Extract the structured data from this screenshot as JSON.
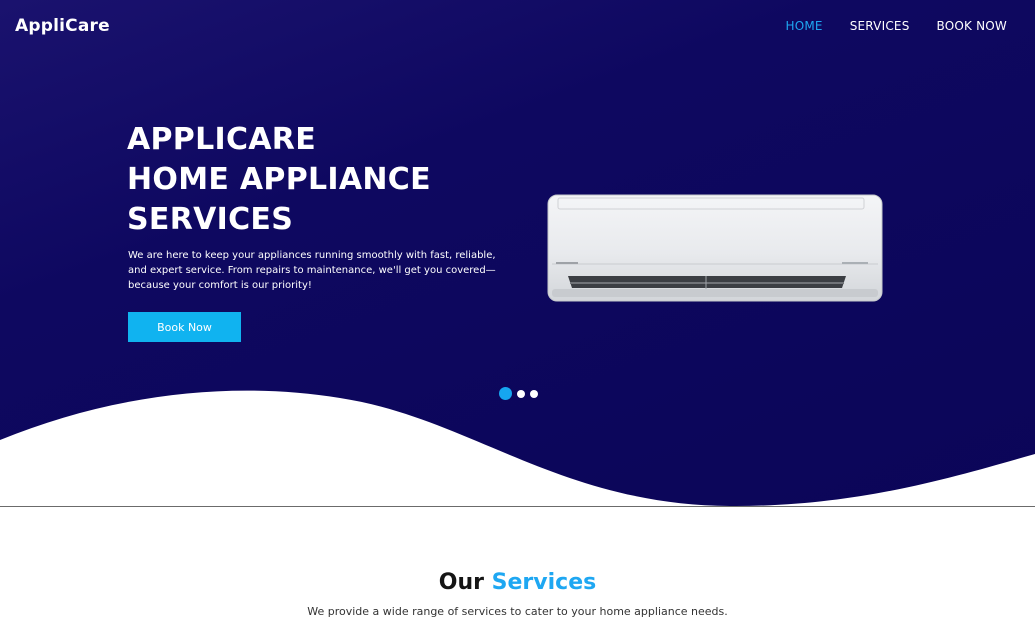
{
  "brand": {
    "name": "AppliCare"
  },
  "nav": {
    "items": [
      {
        "label": "HOME",
        "active": true
      },
      {
        "label": "SERVICES",
        "active": false
      },
      {
        "label": "BOOK NOW",
        "active": false
      }
    ]
  },
  "hero": {
    "title_lines": [
      "APPLICARE",
      "HOME APPLIANCE",
      "SERVICES"
    ],
    "description": "We are here to keep your appliances running smoothly with fast, reliable, and expert service. From repairs to maintenance, we'll get you covered—because your comfort is our priority!",
    "cta_label": "Book Now",
    "image": "wall-mounted-air-conditioner",
    "slider": {
      "count": 3,
      "active_index": 0
    }
  },
  "services_section": {
    "title_part1": "Our",
    "title_part2": "Services",
    "subtitle": "We provide a wide range of services to cater to your home appliance needs."
  },
  "colors": {
    "hero_background": "#0e0860",
    "accent": "#1ea7f2",
    "button": "#10b3f0",
    "white": "#ffffff",
    "text_dark": "#151515"
  }
}
